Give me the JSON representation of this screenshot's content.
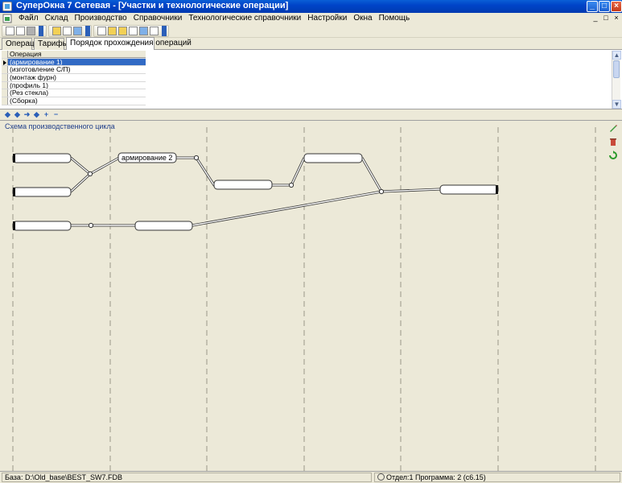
{
  "window": {
    "title": "СуперОкна 7 Сетевая - [Участки и технологические операции]",
    "controls": {
      "minimize": "_",
      "maximize": "□",
      "close": "×"
    }
  },
  "menu": {
    "items": [
      "Файл",
      "Склад",
      "Производство",
      "Справочники",
      "Технологические справочники",
      "Настройки",
      "Окна",
      "Помощь"
    ],
    "window_controls": [
      "_",
      "□",
      "×"
    ]
  },
  "tabs": [
    {
      "label": "Операции"
    },
    {
      "label": "Тарифы"
    },
    {
      "label": "Порядок прохождения операций",
      "active": true
    }
  ],
  "grid": {
    "column_header": "Операция",
    "rows": [
      "(армирование 1)",
      "(изготовление С/П)",
      "(монтаж фурн)",
      "(профиль 1)",
      "(Рез стекла)",
      "(Сборка)"
    ],
    "selected_index": 0
  },
  "navigator": {
    "buttons": [
      "◆",
      "◆",
      "➜",
      "◆",
      "+",
      "−"
    ]
  },
  "schema": {
    "title": "Схема производственного цикла",
    "node_label": "армирование 2",
    "side_tool_icons": [
      "pencil-icon",
      "delete-icon",
      "refresh-icon"
    ]
  },
  "status": {
    "database": "База: D:\\Old_base\\BEST_SW7.FDB",
    "program": "Отдел:1 Программа: 2 (с6.15)"
  }
}
